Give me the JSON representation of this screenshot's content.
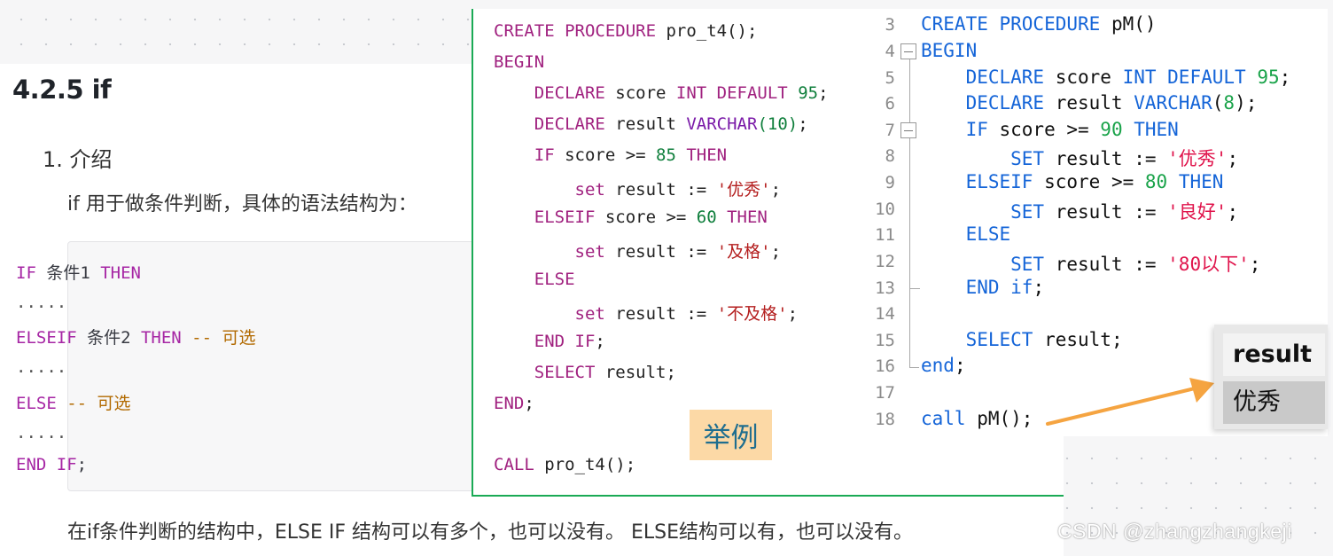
{
  "document": {
    "heading": "4.2.5 if",
    "list_item": "1. 介绍",
    "intro": "if 用于做条件判断，具体的语法结构为：",
    "code": [
      {
        "kw1": "IF",
        "text": " 条件1 ",
        "kw2": "THEN",
        "comment": ""
      },
      {
        "kw1": "",
        "text": ".....",
        "kw2": "",
        "comment": ""
      },
      {
        "kw1": "ELSEIF",
        "text": " 条件2 ",
        "kw2": "THEN",
        "comment": " -- 可选"
      },
      {
        "kw1": "",
        "text": ".....",
        "kw2": "",
        "comment": ""
      },
      {
        "kw1": "ELSE",
        "text": "",
        "kw2": "",
        "comment": " -- 可选"
      },
      {
        "kw1": "",
        "text": ".....",
        "kw2": "",
        "comment": ""
      },
      {
        "kw1": "END IF",
        "text": ";",
        "kw2": "",
        "comment": ""
      }
    ],
    "summary": "在if条件判断的结构中，ELSE IF 结构可以有多个，也可以没有。 ELSE结构可以有，也可以没有。"
  },
  "example_panel": {
    "label": "举例",
    "lines": [
      {
        "a": "CREATE PROCEDURE",
        "b": " pro_t4();"
      },
      {
        "a": "BEGIN",
        "b": ""
      },
      {
        "a": "    DECLARE",
        "b": " score ",
        "c": "INT DEFAULT",
        "d": " 95",
        "e": ";"
      },
      {
        "a": "    DECLARE",
        "b": " result ",
        "c": "VARCHAR",
        "d": "(10)",
        "e": ";"
      },
      {
        "a": "    IF",
        "b": " score >= ",
        "c": "",
        "d": "85",
        "e": " THEN"
      },
      {
        "a": "        set",
        "b": " result := ",
        "s": "'优秀'",
        "e": ";"
      },
      {
        "a": "    ELSEIF",
        "b": " score >= ",
        "c": "",
        "d": "60",
        "e": " THEN"
      },
      {
        "a": "        set",
        "b": " result := ",
        "s": "'及格'",
        "e": ";"
      },
      {
        "a": "    ELSE",
        "b": ""
      },
      {
        "a": "        set",
        "b": " result := ",
        "s": "'不及格'",
        "e": ";"
      },
      {
        "a": "    END IF",
        "b": ";"
      },
      {
        "a": "    SELECT",
        "b": " result;"
      },
      {
        "a": "END",
        "b": ";"
      },
      {
        "a": "",
        "b": ""
      },
      {
        "a": "CALL",
        "b": " pro_t4();"
      }
    ]
  },
  "editor": {
    "line_numbers": [
      "3",
      "4",
      "5",
      "6",
      "7",
      "8",
      "9",
      "10",
      "11",
      "12",
      "13",
      "14",
      "15",
      "16",
      "17",
      "18"
    ],
    "lines": [
      {
        "k1": "CREATE PROCEDURE",
        "t1": " pM()"
      },
      {
        "k1": "BEGIN",
        "t1": ""
      },
      {
        "k1": "    DECLARE",
        "t1": " score ",
        "k2": "INT DEFAULT",
        "n": " 95",
        "t2": ";"
      },
      {
        "k1": "    DECLARE",
        "t1": " result ",
        "k2": "VARCHAR",
        "t2": "(",
        "n": "8",
        "t3": ");"
      },
      {
        "k1": "    IF",
        "t1": " score >= ",
        "n": "90",
        "k2": " THEN"
      },
      {
        "k1": "        SET",
        "t1": " result := ",
        "s": "'优秀'",
        "t2": ";"
      },
      {
        "k1": "    ELSEIF",
        "t1": " score >= ",
        "n": "80",
        "k2": " THEN"
      },
      {
        "k1": "        SET",
        "t1": " result := ",
        "s": "'良好'",
        "t2": ";"
      },
      {
        "k1": "    ELSE",
        "t1": ""
      },
      {
        "k1": "        SET",
        "t1": " result := ",
        "s": "'80以下'",
        "t2": ";"
      },
      {
        "k1": "    END",
        "k2": " if",
        "t1": ";"
      },
      {
        "k1": "",
        "t1": ""
      },
      {
        "k1": "    SELECT",
        "t1": " result;"
      },
      {
        "k1": "end",
        "t1": ";"
      },
      {
        "k1": "",
        "t1": ""
      },
      {
        "k1": "call",
        "t1": " pM();"
      }
    ]
  },
  "result_grid": {
    "header": "result",
    "value": "优秀"
  },
  "watermark": "CSDN @zhangzhangkeji",
  "colors": {
    "panel_border": "#1aaa55",
    "arrow": "#f5a441",
    "label_bg": "#fcd9a6"
  }
}
